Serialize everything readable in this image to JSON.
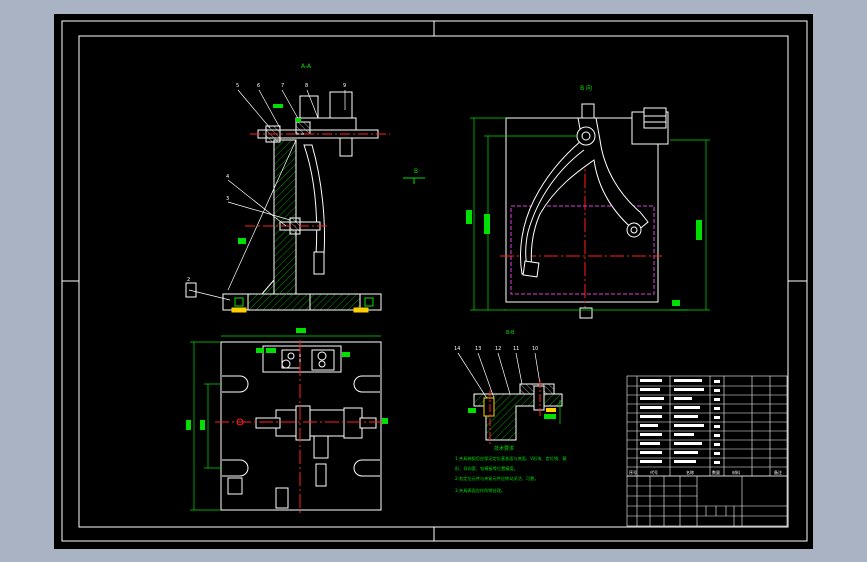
{
  "colors": {
    "background": "#a9b3c3",
    "canvas": "#000000",
    "outline": "#ffffff",
    "dimension": "#00e000",
    "centerline": "#ff2020",
    "hidden": "#e040e0",
    "leader": "#ffffff"
  },
  "views": {
    "section_a": {
      "title": "A-A"
    },
    "view_b": {
      "title": "B 向",
      "arrow_label": "B"
    },
    "plan": {},
    "section_b": {
      "title": "B-B"
    }
  },
  "balloons": {
    "top": [
      "5",
      "6",
      "7",
      "8",
      "9"
    ],
    "left": [
      "4",
      "3",
      "2"
    ],
    "section_b": [
      "14",
      "13",
      "12",
      "11",
      "10"
    ]
  },
  "notes": {
    "title": "技术要求",
    "lines": [
      "1.夹具装配后应保证定位基准面与底面、V形块、定位销、菱",
      "形、导向套、钻模板等位置精度。",
      "2.各定位元件与夹紧元件应转动灵活、可靠。",
      "3.夹具表面应作防锈处理。"
    ]
  },
  "bom": {
    "header": [
      "序号",
      "代号",
      "名称",
      "数量",
      "材料",
      "备注"
    ],
    "rows": 10
  }
}
